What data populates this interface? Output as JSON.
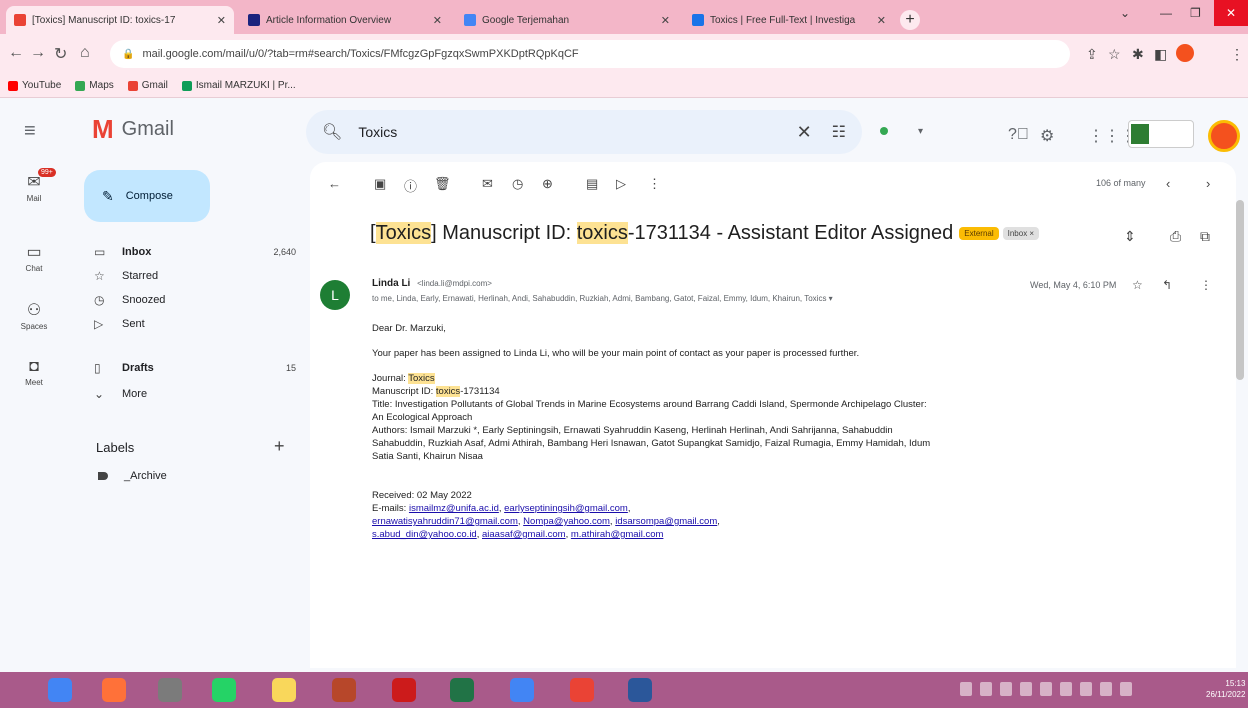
{
  "browser": {
    "tabs": [
      {
        "title": "[Toxics] Manuscript ID: toxics-17",
        "favicon_color": "#ea4335",
        "active": true
      },
      {
        "title": "Article Information Overview",
        "favicon_color": "#1a237e",
        "active": false
      },
      {
        "title": "Google Terjemahan",
        "favicon_color": "#4285f4",
        "active": false
      },
      {
        "title": "Toxics | Free Full-Text | Investiga",
        "favicon_color": "#1a73e8",
        "active": false
      }
    ],
    "url": "mail.google.com/mail/u/0/?tab=rm#search/Toxics/FMfcgzGpFgzqxSwmPXKDptRQpKqCF",
    "bookmarks": [
      "YouTube",
      "Maps",
      "Gmail",
      "Ismail MARZUKI | Pr..."
    ]
  },
  "gmail": {
    "app_name": "Gmail",
    "search_query": "Toxics",
    "rail": [
      {
        "label": "Mail",
        "icon": "mail-icon",
        "badge": "99+"
      },
      {
        "label": "Chat",
        "icon": "chat-icon"
      },
      {
        "label": "Spaces",
        "icon": "spaces-icon"
      },
      {
        "label": "Meet",
        "icon": "meet-icon"
      }
    ],
    "compose_label": "Compose",
    "nav": [
      {
        "label": "Inbox",
        "count": "2,640",
        "icon": "inbox-icon",
        "bold": true
      },
      {
        "label": "Starred",
        "count": "",
        "icon": "star-icon",
        "bold": false
      },
      {
        "label": "Snoozed",
        "count": "",
        "icon": "clock-icon",
        "bold": false
      },
      {
        "label": "Sent",
        "count": "",
        "icon": "send-icon",
        "bold": false
      },
      {
        "label": "Drafts",
        "count": "15",
        "icon": "draft-icon",
        "bold": true
      },
      {
        "label": "More",
        "count": "",
        "icon": "chevron-down-icon",
        "bold": false
      }
    ],
    "labels_heading": "Labels",
    "labels": [
      "_Archive"
    ],
    "pager": "106 of many"
  },
  "email": {
    "subject_hl1": "Toxics",
    "subject_mid": "] Manuscript ID: ",
    "subject_hl2": "toxics",
    "subject_end": "-1731134 - Assistant Editor Assigned",
    "external_badge": "External",
    "inbox_badge": "Inbox ×",
    "sender_name": "Linda Li",
    "sender_email": "<linda.li@mdpi.com>",
    "recipients": "to me, Linda, Early, Ernawati, Herlinah, Andi, Sahabuddin, Ruzkiah, Admi, Bambang, Gatot, Faizal, Emmy, Idum, Khairun, Toxics ▾",
    "datetime": "Wed, May 4, 6:10 PM",
    "greeting": "Dear Dr. Marzuki,",
    "para1": "Your paper has been assigned to Linda Li, who will be your main point of contact as your paper is processed further.",
    "journal_label": "Journal: ",
    "journal_value": "Toxics",
    "manuscript_label": "Manuscript ID: ",
    "manuscript_hl": "toxics",
    "manuscript_rest": "-1731134",
    "title_line": "Title: Investigation Pollutants of Global Trends in Marine Ecosystems around Barrang Caddi Island, Spermonde Archipelago Cluster: An Ecological Approach",
    "authors_line": "Authors: Ismail Marzuki *, Early Septiningsih, Ernawati Syahruddin Kaseng, Herlinah Herlinah, Andi Sahrijanna, Sahabuddin Sahabuddin, Ruzkiah Asaf, Admi Athirah, Bambang Heri Isnawan, Gatot Supangkat Samidjo, Faizal Rumagia, Emmy Hamidah, Idum Satia Santi, Khairun Nisaa",
    "received": "Received: 02 May 2022",
    "emails_label": "E-mails: ",
    "emails": [
      "ismailmz@unifa.ac.id",
      "earlyseptiningsih@gmail.com",
      "ernawatisyahruddin71@gmail.com",
      "Nompa@yahoo.com",
      "idsarsompa@gmail.com",
      "s.abud_din@yahoo.co.id",
      "aiaasaf@gmail.com",
      "m.athirah@gmail.com"
    ]
  },
  "taskbar": {
    "apps": [
      {
        "name": "chrome",
        "color": "#4285f4"
      },
      {
        "name": "firefox",
        "color": "#ff7139"
      },
      {
        "name": "app3",
        "color": "#7b7b7b"
      },
      {
        "name": "whatsapp",
        "color": "#25d366"
      },
      {
        "name": "explorer",
        "color": "#f9d75b"
      },
      {
        "name": "app6",
        "color": "#b7472a"
      },
      {
        "name": "opera",
        "color": "#cc1b1b"
      },
      {
        "name": "excel",
        "color": "#217346"
      },
      {
        "name": "chrome2",
        "color": "#4285f4"
      },
      {
        "name": "chrome3",
        "color": "#ea4335"
      },
      {
        "name": "word",
        "color": "#2b579a"
      }
    ],
    "time": "15:13",
    "date": "26/11/2022"
  }
}
